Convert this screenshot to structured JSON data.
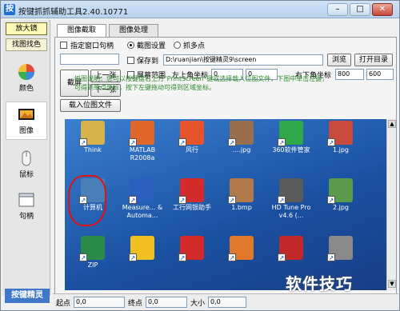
{
  "window": {
    "title": "按键抓抓辅助工具2.40.10771",
    "app_icon": "按"
  },
  "sidebar": {
    "magnifier_button": "放大镜",
    "find_color_button": "找图找色",
    "items": [
      {
        "label": "颜色",
        "icon": "color-palette-icon"
      },
      {
        "label": "图像",
        "icon": "image-icon"
      },
      {
        "label": "鼠标",
        "icon": "mouse-icon"
      },
      {
        "label": "句柄",
        "icon": "window-handle-icon"
      }
    ],
    "logo": "按键精灵"
  },
  "tabs": [
    "图像截取",
    "图像处理"
  ],
  "capture": {
    "specify_handle_label": "指定窗口句柄",
    "screenshot_button": "截屏",
    "prev_button": "上一张",
    "next_button": "下一张",
    "load_button": "载入位图文件",
    "screenshot_setting_label": "截图设置",
    "capture_point_label": "抓多点",
    "save_to_label": "保存到",
    "save_path": "D:\\ruanjian\\按键精灵9\\screen",
    "browse_button": "浏览",
    "open_dir_button": "打开目录",
    "screen_range_label": "屏幕范围",
    "top_left_label": "左上角坐标",
    "top_left_x": "0",
    "top_left_y": "0",
    "bottom_right_label": "右下角坐标",
    "bottom_right_x": "800",
    "bottom_right_y": "600",
    "help_text": "抓图说明：您可以按键盘右上方\"PrintScreen\"键或选择载入位图文件，下图中单击左键，可得到单点坐标，按下左键拖动可得到区域坐标。"
  },
  "desktop_icons": [
    {
      "label": "Think",
      "color": "#d8b24a"
    },
    {
      "label": "MATLAB R2008a",
      "color": "#e0672a"
    },
    {
      "label": "风行",
      "color": "#e8542a"
    },
    {
      "label": "....jpg",
      "color": "#9a6f4e"
    },
    {
      "label": "360软件管家",
      "color": "#2fa84a"
    },
    {
      "label": "1.jpg",
      "color": "#c84a3a"
    },
    {
      "label": "计算机",
      "color": "#4a7fb8"
    },
    {
      "label": "Measure... & Automa...",
      "color": "#2a5fc0"
    },
    {
      "label": "工行网银助手",
      "color": "#d42a2a"
    },
    {
      "label": "1.bmp",
      "color": "#b07a4a"
    },
    {
      "label": "HD Tune Pro v4.6 (...",
      "color": "#5a5a5a"
    },
    {
      "label": "2.jpg",
      "color": "#5a9a4a"
    },
    {
      "label": "ZIP",
      "color": "#2a8a4a"
    },
    {
      "label": "",
      "color": "#f0c020"
    },
    {
      "label": "",
      "color": "#d42a2a"
    },
    {
      "label": "",
      "color": "#e07a2a"
    },
    {
      "label": "",
      "color": "#c0282a"
    },
    {
      "label": "",
      "color": "#8a8a8a"
    }
  ],
  "status": {
    "start_label": "起点",
    "start_value": "0,0",
    "end_label": "终点",
    "end_value": "0,0",
    "size_label": "大小",
    "size_value": "0,0"
  },
  "watermark": "软件技巧"
}
